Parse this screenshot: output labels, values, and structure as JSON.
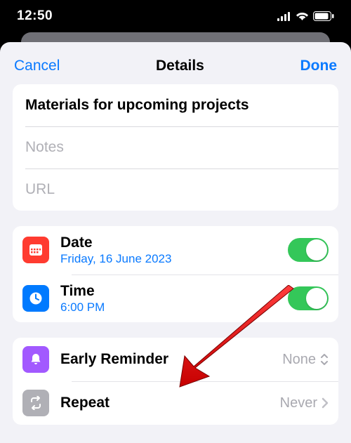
{
  "status": {
    "time": "12:50"
  },
  "header": {
    "cancel": "Cancel",
    "title": "Details",
    "done": "Done"
  },
  "fields": {
    "title": "Materials for upcoming projects",
    "notes_placeholder": "Notes",
    "url_placeholder": "URL"
  },
  "rows": {
    "date": {
      "label": "Date",
      "sub": "Friday, 16 June 2023"
    },
    "time": {
      "label": "Time",
      "sub": "6:00 PM"
    },
    "early": {
      "label": "Early Reminder",
      "value": "None"
    },
    "repeat": {
      "label": "Repeat",
      "value": "Never"
    }
  }
}
